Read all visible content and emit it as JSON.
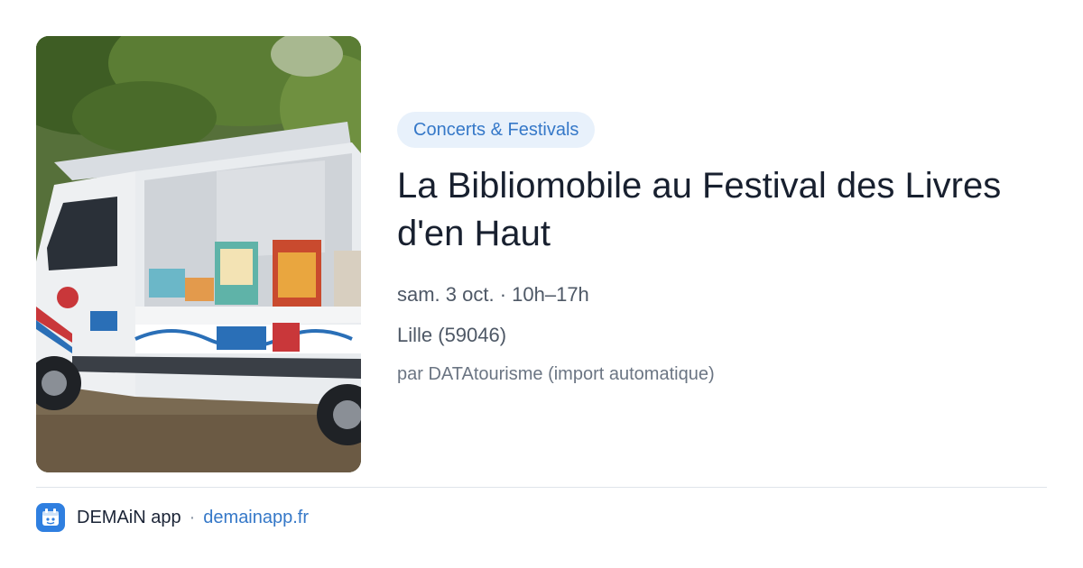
{
  "card": {
    "category": "Concerts & Festivals",
    "title": "La Bibliomobile au Festival des Livres d'en Haut",
    "date_time": "sam. 3 oct. · 10h–17h",
    "location": "Lille (59046)",
    "source": "par DATAtourisme (import automatique)",
    "image_alt": "Bibliomobile van with open side displaying books"
  },
  "footer": {
    "app_name": "DEMAiN app",
    "separator": "·",
    "url": "demainapp.fr",
    "icon": "demain-app-icon"
  },
  "colors": {
    "accent": "#3578c8",
    "tag_background": "#e8f1fb",
    "app_icon": "#2f7fe0"
  }
}
